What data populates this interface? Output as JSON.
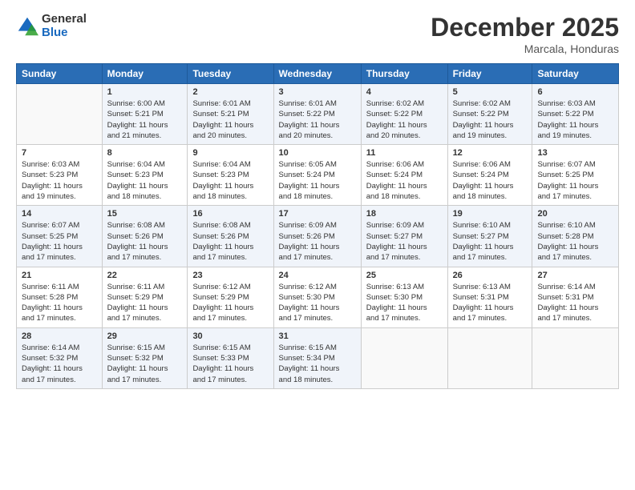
{
  "header": {
    "logo_general": "General",
    "logo_blue": "Blue",
    "month_title": "December 2025",
    "location": "Marcala, Honduras"
  },
  "calendar": {
    "days_of_week": [
      "Sunday",
      "Monday",
      "Tuesday",
      "Wednesday",
      "Thursday",
      "Friday",
      "Saturday"
    ],
    "weeks": [
      [
        {
          "day": "",
          "info": ""
        },
        {
          "day": "1",
          "info": "Sunrise: 6:00 AM\nSunset: 5:21 PM\nDaylight: 11 hours\nand 21 minutes."
        },
        {
          "day": "2",
          "info": "Sunrise: 6:01 AM\nSunset: 5:21 PM\nDaylight: 11 hours\nand 20 minutes."
        },
        {
          "day": "3",
          "info": "Sunrise: 6:01 AM\nSunset: 5:22 PM\nDaylight: 11 hours\nand 20 minutes."
        },
        {
          "day": "4",
          "info": "Sunrise: 6:02 AM\nSunset: 5:22 PM\nDaylight: 11 hours\nand 20 minutes."
        },
        {
          "day": "5",
          "info": "Sunrise: 6:02 AM\nSunset: 5:22 PM\nDaylight: 11 hours\nand 19 minutes."
        },
        {
          "day": "6",
          "info": "Sunrise: 6:03 AM\nSunset: 5:22 PM\nDaylight: 11 hours\nand 19 minutes."
        }
      ],
      [
        {
          "day": "7",
          "info": "Sunrise: 6:03 AM\nSunset: 5:23 PM\nDaylight: 11 hours\nand 19 minutes."
        },
        {
          "day": "8",
          "info": "Sunrise: 6:04 AM\nSunset: 5:23 PM\nDaylight: 11 hours\nand 18 minutes."
        },
        {
          "day": "9",
          "info": "Sunrise: 6:04 AM\nSunset: 5:23 PM\nDaylight: 11 hours\nand 18 minutes."
        },
        {
          "day": "10",
          "info": "Sunrise: 6:05 AM\nSunset: 5:24 PM\nDaylight: 11 hours\nand 18 minutes."
        },
        {
          "day": "11",
          "info": "Sunrise: 6:06 AM\nSunset: 5:24 PM\nDaylight: 11 hours\nand 18 minutes."
        },
        {
          "day": "12",
          "info": "Sunrise: 6:06 AM\nSunset: 5:24 PM\nDaylight: 11 hours\nand 18 minutes."
        },
        {
          "day": "13",
          "info": "Sunrise: 6:07 AM\nSunset: 5:25 PM\nDaylight: 11 hours\nand 17 minutes."
        }
      ],
      [
        {
          "day": "14",
          "info": "Sunrise: 6:07 AM\nSunset: 5:25 PM\nDaylight: 11 hours\nand 17 minutes."
        },
        {
          "day": "15",
          "info": "Sunrise: 6:08 AM\nSunset: 5:26 PM\nDaylight: 11 hours\nand 17 minutes."
        },
        {
          "day": "16",
          "info": "Sunrise: 6:08 AM\nSunset: 5:26 PM\nDaylight: 11 hours\nand 17 minutes."
        },
        {
          "day": "17",
          "info": "Sunrise: 6:09 AM\nSunset: 5:26 PM\nDaylight: 11 hours\nand 17 minutes."
        },
        {
          "day": "18",
          "info": "Sunrise: 6:09 AM\nSunset: 5:27 PM\nDaylight: 11 hours\nand 17 minutes."
        },
        {
          "day": "19",
          "info": "Sunrise: 6:10 AM\nSunset: 5:27 PM\nDaylight: 11 hours\nand 17 minutes."
        },
        {
          "day": "20",
          "info": "Sunrise: 6:10 AM\nSunset: 5:28 PM\nDaylight: 11 hours\nand 17 minutes."
        }
      ],
      [
        {
          "day": "21",
          "info": "Sunrise: 6:11 AM\nSunset: 5:28 PM\nDaylight: 11 hours\nand 17 minutes."
        },
        {
          "day": "22",
          "info": "Sunrise: 6:11 AM\nSunset: 5:29 PM\nDaylight: 11 hours\nand 17 minutes."
        },
        {
          "day": "23",
          "info": "Sunrise: 6:12 AM\nSunset: 5:29 PM\nDaylight: 11 hours\nand 17 minutes."
        },
        {
          "day": "24",
          "info": "Sunrise: 6:12 AM\nSunset: 5:30 PM\nDaylight: 11 hours\nand 17 minutes."
        },
        {
          "day": "25",
          "info": "Sunrise: 6:13 AM\nSunset: 5:30 PM\nDaylight: 11 hours\nand 17 minutes."
        },
        {
          "day": "26",
          "info": "Sunrise: 6:13 AM\nSunset: 5:31 PM\nDaylight: 11 hours\nand 17 minutes."
        },
        {
          "day": "27",
          "info": "Sunrise: 6:14 AM\nSunset: 5:31 PM\nDaylight: 11 hours\nand 17 minutes."
        }
      ],
      [
        {
          "day": "28",
          "info": "Sunrise: 6:14 AM\nSunset: 5:32 PM\nDaylight: 11 hours\nand 17 minutes."
        },
        {
          "day": "29",
          "info": "Sunrise: 6:15 AM\nSunset: 5:32 PM\nDaylight: 11 hours\nand 17 minutes."
        },
        {
          "day": "30",
          "info": "Sunrise: 6:15 AM\nSunset: 5:33 PM\nDaylight: 11 hours\nand 17 minutes."
        },
        {
          "day": "31",
          "info": "Sunrise: 6:15 AM\nSunset: 5:34 PM\nDaylight: 11 hours\nand 18 minutes."
        },
        {
          "day": "",
          "info": ""
        },
        {
          "day": "",
          "info": ""
        },
        {
          "day": "",
          "info": ""
        }
      ]
    ]
  }
}
